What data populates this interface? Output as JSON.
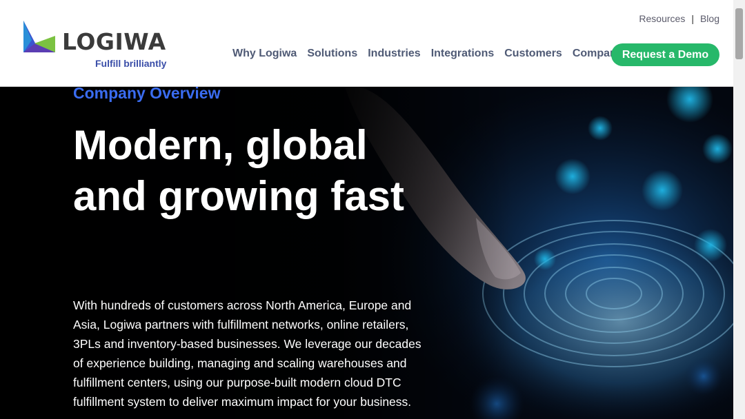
{
  "brand": {
    "name": "LOGIWA",
    "tagline": "Fulfill brilliantly",
    "colors": {
      "mark_blue": "#2f57c9",
      "mark_green": "#7bc241",
      "mark_purple": "#5b3db3"
    }
  },
  "utility_nav": {
    "resources": "Resources",
    "separator": "|",
    "blog": "Blog"
  },
  "main_nav": {
    "items": [
      "Why Logiwa",
      "Solutions",
      "Industries",
      "Integrations",
      "Customers",
      "Company"
    ],
    "cta": "Request a Demo",
    "cta_color": "#27b86a"
  },
  "hero": {
    "eyebrow": "Company Overview",
    "headline": "Modern, global and growing fast",
    "body": "With hundreds of customers across North America, Europe and Asia, Logiwa partners with fulfillment networks, online retailers, 3PLs and inventory-based businesses. We leverage our decades of experience building, managing and scaling warehouses and fulfillment centers, using our purpose-built modern cloud DTC fulfillment system to deliver maximum impact for your business.",
    "image_subject": "finger-touching-glowing-fingerprint-circuit"
  }
}
